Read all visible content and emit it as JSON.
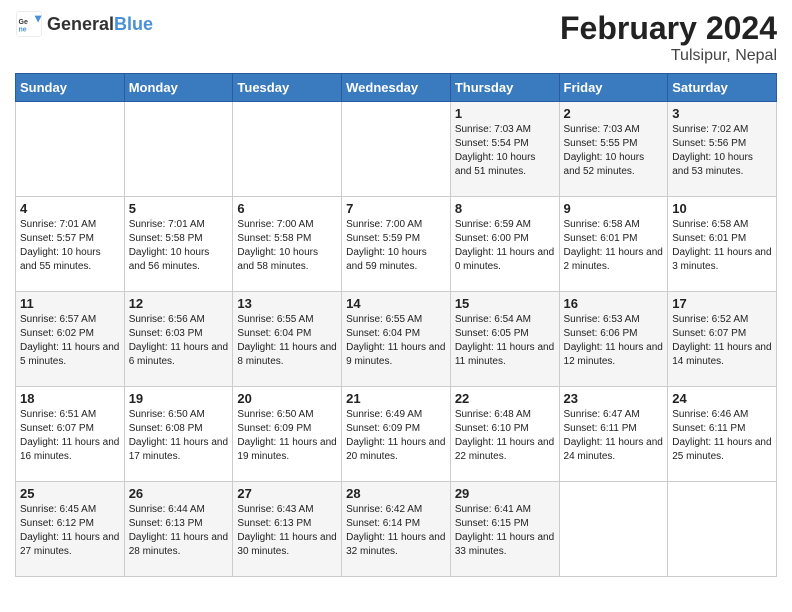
{
  "logo": {
    "general": "General",
    "blue": "Blue"
  },
  "title": "February 2024",
  "subtitle": "Tulsipur, Nepal",
  "days_of_week": [
    "Sunday",
    "Monday",
    "Tuesday",
    "Wednesday",
    "Thursday",
    "Friday",
    "Saturday"
  ],
  "weeks": [
    [
      {
        "day": "",
        "info": ""
      },
      {
        "day": "",
        "info": ""
      },
      {
        "day": "",
        "info": ""
      },
      {
        "day": "",
        "info": ""
      },
      {
        "day": "1",
        "info": "Sunrise: 7:03 AM\nSunset: 5:54 PM\nDaylight: 10 hours and 51 minutes."
      },
      {
        "day": "2",
        "info": "Sunrise: 7:03 AM\nSunset: 5:55 PM\nDaylight: 10 hours and 52 minutes."
      },
      {
        "day": "3",
        "info": "Sunrise: 7:02 AM\nSunset: 5:56 PM\nDaylight: 10 hours and 53 minutes."
      }
    ],
    [
      {
        "day": "4",
        "info": "Sunrise: 7:01 AM\nSunset: 5:57 PM\nDaylight: 10 hours and 55 minutes."
      },
      {
        "day": "5",
        "info": "Sunrise: 7:01 AM\nSunset: 5:58 PM\nDaylight: 10 hours and 56 minutes."
      },
      {
        "day": "6",
        "info": "Sunrise: 7:00 AM\nSunset: 5:58 PM\nDaylight: 10 hours and 58 minutes."
      },
      {
        "day": "7",
        "info": "Sunrise: 7:00 AM\nSunset: 5:59 PM\nDaylight: 10 hours and 59 minutes."
      },
      {
        "day": "8",
        "info": "Sunrise: 6:59 AM\nSunset: 6:00 PM\nDaylight: 11 hours and 0 minutes."
      },
      {
        "day": "9",
        "info": "Sunrise: 6:58 AM\nSunset: 6:01 PM\nDaylight: 11 hours and 2 minutes."
      },
      {
        "day": "10",
        "info": "Sunrise: 6:58 AM\nSunset: 6:01 PM\nDaylight: 11 hours and 3 minutes."
      }
    ],
    [
      {
        "day": "11",
        "info": "Sunrise: 6:57 AM\nSunset: 6:02 PM\nDaylight: 11 hours and 5 minutes."
      },
      {
        "day": "12",
        "info": "Sunrise: 6:56 AM\nSunset: 6:03 PM\nDaylight: 11 hours and 6 minutes."
      },
      {
        "day": "13",
        "info": "Sunrise: 6:55 AM\nSunset: 6:04 PM\nDaylight: 11 hours and 8 minutes."
      },
      {
        "day": "14",
        "info": "Sunrise: 6:55 AM\nSunset: 6:04 PM\nDaylight: 11 hours and 9 minutes."
      },
      {
        "day": "15",
        "info": "Sunrise: 6:54 AM\nSunset: 6:05 PM\nDaylight: 11 hours and 11 minutes."
      },
      {
        "day": "16",
        "info": "Sunrise: 6:53 AM\nSunset: 6:06 PM\nDaylight: 11 hours and 12 minutes."
      },
      {
        "day": "17",
        "info": "Sunrise: 6:52 AM\nSunset: 6:07 PM\nDaylight: 11 hours and 14 minutes."
      }
    ],
    [
      {
        "day": "18",
        "info": "Sunrise: 6:51 AM\nSunset: 6:07 PM\nDaylight: 11 hours and 16 minutes."
      },
      {
        "day": "19",
        "info": "Sunrise: 6:50 AM\nSunset: 6:08 PM\nDaylight: 11 hours and 17 minutes."
      },
      {
        "day": "20",
        "info": "Sunrise: 6:50 AM\nSunset: 6:09 PM\nDaylight: 11 hours and 19 minutes."
      },
      {
        "day": "21",
        "info": "Sunrise: 6:49 AM\nSunset: 6:09 PM\nDaylight: 11 hours and 20 minutes."
      },
      {
        "day": "22",
        "info": "Sunrise: 6:48 AM\nSunset: 6:10 PM\nDaylight: 11 hours and 22 minutes."
      },
      {
        "day": "23",
        "info": "Sunrise: 6:47 AM\nSunset: 6:11 PM\nDaylight: 11 hours and 24 minutes."
      },
      {
        "day": "24",
        "info": "Sunrise: 6:46 AM\nSunset: 6:11 PM\nDaylight: 11 hours and 25 minutes."
      }
    ],
    [
      {
        "day": "25",
        "info": "Sunrise: 6:45 AM\nSunset: 6:12 PM\nDaylight: 11 hours and 27 minutes."
      },
      {
        "day": "26",
        "info": "Sunrise: 6:44 AM\nSunset: 6:13 PM\nDaylight: 11 hours and 28 minutes."
      },
      {
        "day": "27",
        "info": "Sunrise: 6:43 AM\nSunset: 6:13 PM\nDaylight: 11 hours and 30 minutes."
      },
      {
        "day": "28",
        "info": "Sunrise: 6:42 AM\nSunset: 6:14 PM\nDaylight: 11 hours and 32 minutes."
      },
      {
        "day": "29",
        "info": "Sunrise: 6:41 AM\nSunset: 6:15 PM\nDaylight: 11 hours and 33 minutes."
      },
      {
        "day": "",
        "info": ""
      },
      {
        "day": "",
        "info": ""
      }
    ]
  ]
}
